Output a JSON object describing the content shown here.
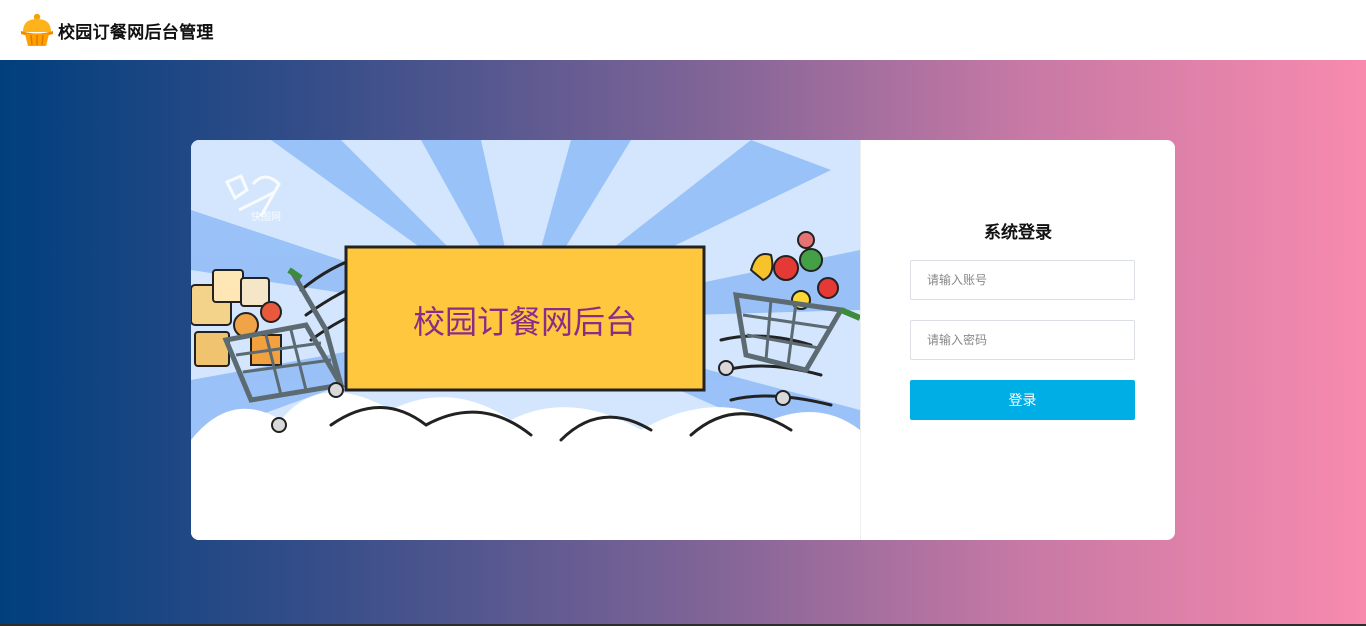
{
  "header": {
    "title": "校园订餐网后台管理",
    "logo_icon": "cupcake-icon"
  },
  "banner": {
    "title": "校园订餐网后台",
    "watermark": "快图网"
  },
  "login": {
    "title": "系统登录",
    "account_placeholder": "请输入账号",
    "account_value": "",
    "password_placeholder": "请输入密码",
    "password_value": "",
    "submit_label": "登录"
  },
  "colors": {
    "gradient_start": "#003f7d",
    "gradient_end": "#f88aae",
    "button": "#00aee6",
    "banner_box": "#fec73e",
    "banner_text": "#8a2c86"
  }
}
